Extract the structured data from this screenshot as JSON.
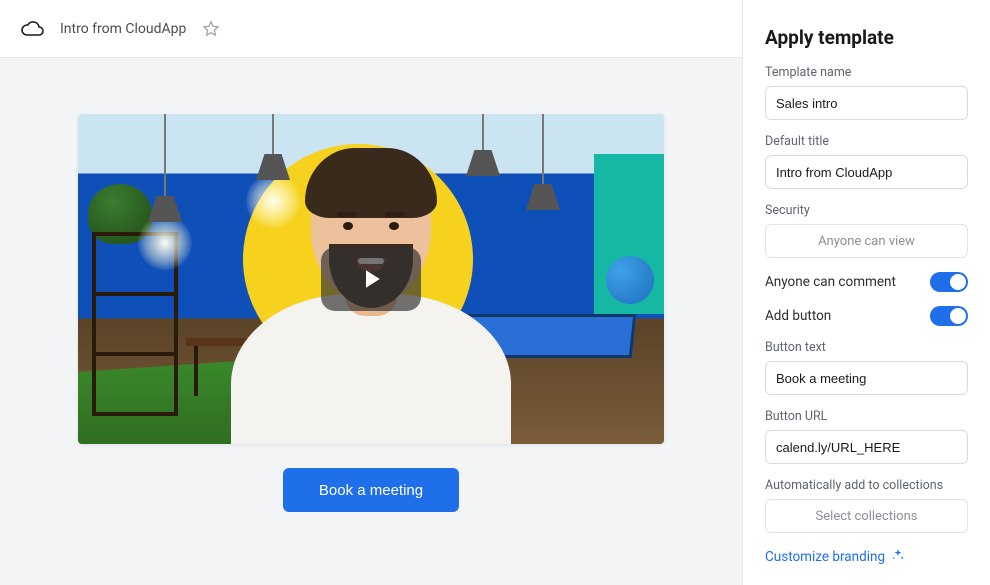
{
  "header": {
    "title": "Intro from CloudApp"
  },
  "preview": {
    "cta_label": "Book a meeting"
  },
  "sidebar": {
    "heading": "Apply template",
    "template_name_label": "Template name",
    "template_name_value": "Sales intro",
    "default_title_label": "Default title",
    "default_title_value": "Intro from CloudApp",
    "security_label": "Security",
    "security_value": "Anyone can view",
    "comment_toggle_label": "Anyone can comment",
    "add_button_toggle_label": "Add button",
    "button_text_label": "Button text",
    "button_text_value": "Book a meeting",
    "button_url_label": "Button URL",
    "button_url_value": "calend.ly/URL_HERE",
    "collections_label": "Automatically add to collections",
    "collections_placeholder": "Select collections",
    "customize_branding_label": "Customize branding"
  },
  "colors": {
    "accent": "#1f6feb"
  }
}
